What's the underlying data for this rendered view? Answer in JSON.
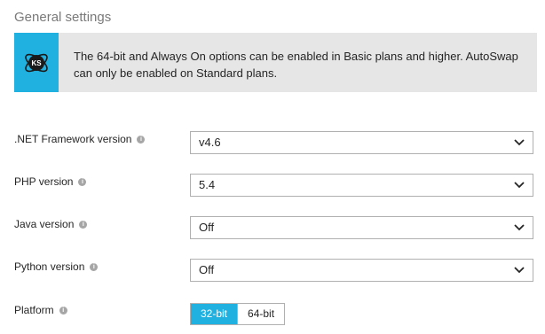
{
  "section": {
    "title": "General settings"
  },
  "banner": {
    "icon": "kudu-logo-icon",
    "text": "The 64-bit and Always On options can be enabled in Basic plans and higher. AutoSwap can only be enabled on Standard plans."
  },
  "settings": [
    {
      "label": ".NET Framework version",
      "value": "v4.6"
    },
    {
      "label": "PHP version",
      "value": "5.4"
    },
    {
      "label": "Java version",
      "value": "Off"
    },
    {
      "label": "Python version",
      "value": "Off"
    }
  ],
  "platform": {
    "label": "Platform",
    "options": [
      "32-bit",
      "64-bit"
    ],
    "selected": "32-bit"
  },
  "colors": {
    "accent": "#20b1e0",
    "banner_bg": "#e6e6e6",
    "help_icon": "#a6a6a6"
  },
  "help_icon_glyph": "i"
}
